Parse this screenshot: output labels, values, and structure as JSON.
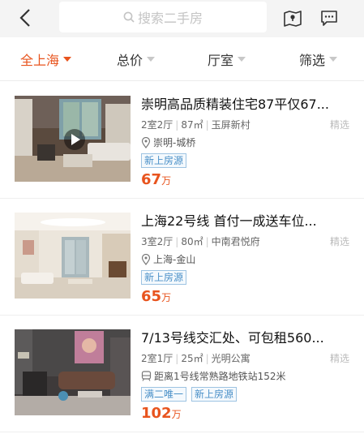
{
  "search": {
    "placeholder": "搜索二手房"
  },
  "filters": [
    {
      "label": "全上海",
      "active": true
    },
    {
      "label": "总价",
      "active": false
    },
    {
      "label": "厅室",
      "active": false
    },
    {
      "label": "筛选",
      "active": false
    }
  ],
  "listings": [
    {
      "title": "崇明高品质精装住宅87平仅67...",
      "layout": "2室2厅",
      "area": "87㎡",
      "community": "玉屏新村",
      "location": "崇明-城桥",
      "location_icon": "pin-icon",
      "featured": "精选",
      "tags": [
        "新上房源"
      ],
      "price": "67",
      "price_unit": "万",
      "has_video": true
    },
    {
      "title": "上海22号线 首付一成送车位...",
      "layout": "3室2厅",
      "area": "80㎡",
      "community": "中南君悦府",
      "location": "上海-金山",
      "location_icon": "pin-icon",
      "featured": "精选",
      "tags": [
        "新上房源"
      ],
      "price": "65",
      "price_unit": "万",
      "has_video": false
    },
    {
      "title": "7/13号线交汇处、可包租560...",
      "layout": "2室1厅",
      "area": "25㎡",
      "community": "光明公寓",
      "location": "距离1号线常熟路地铁站152米",
      "location_icon": "metro-icon",
      "featured": "精选",
      "tags": [
        "满二唯一",
        "新上房源"
      ],
      "price": "102",
      "price_unit": "万",
      "has_video": false
    }
  ]
}
